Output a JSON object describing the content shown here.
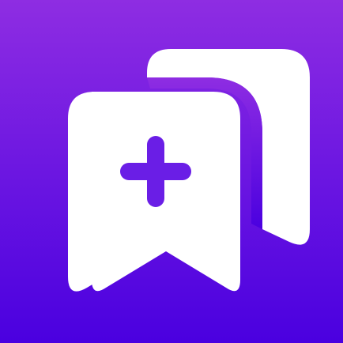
{
  "app_icon": {
    "name": "bookmark-add-app-icon",
    "colors": {
      "background_top": "#8e2de2",
      "background_bottom": "#4a00e0",
      "glyph": "#ffffff",
      "plus": "#6a1ee6"
    },
    "icons": {
      "front": "bookmark-icon",
      "back": "bookmark-icon",
      "plus": "plus-icon"
    }
  }
}
